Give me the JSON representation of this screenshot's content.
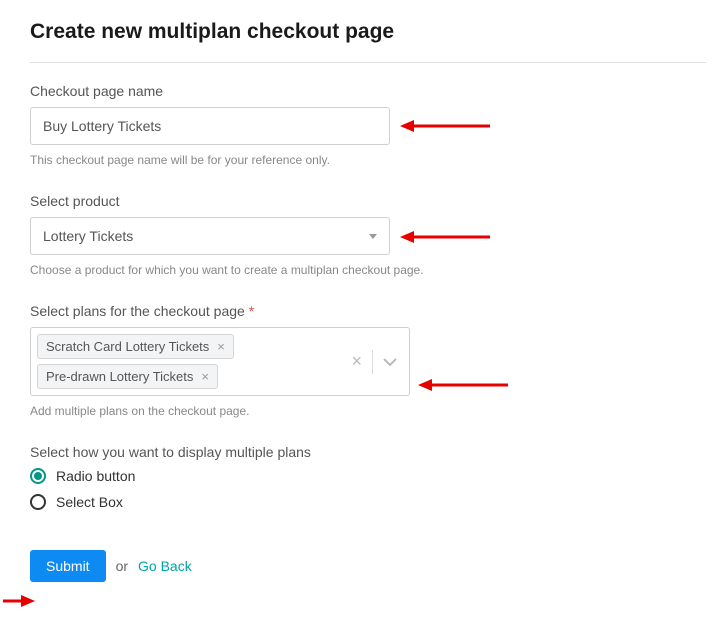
{
  "title": "Create new multiplan checkout page",
  "field1": {
    "label": "Checkout page name",
    "value": "Buy Lottery Tickets",
    "helper": "This checkout page name will be for your reference only."
  },
  "field2": {
    "label": "Select product",
    "value": "Lottery Tickets",
    "helper": "Choose a product for which you want to create a multiplan checkout page."
  },
  "field3": {
    "label": "Select plans for the checkout page ",
    "required": "*",
    "tags": [
      "Scratch Card Lottery Tickets",
      "Pre-drawn Lottery Tickets"
    ],
    "helper": "Add multiple plans on the checkout page."
  },
  "field4": {
    "label": "Select how you want to display multiple plans",
    "options": [
      "Radio button",
      "Select Box"
    ]
  },
  "actions": {
    "submit": "Submit",
    "or": "or",
    "goback": "Go Back"
  }
}
